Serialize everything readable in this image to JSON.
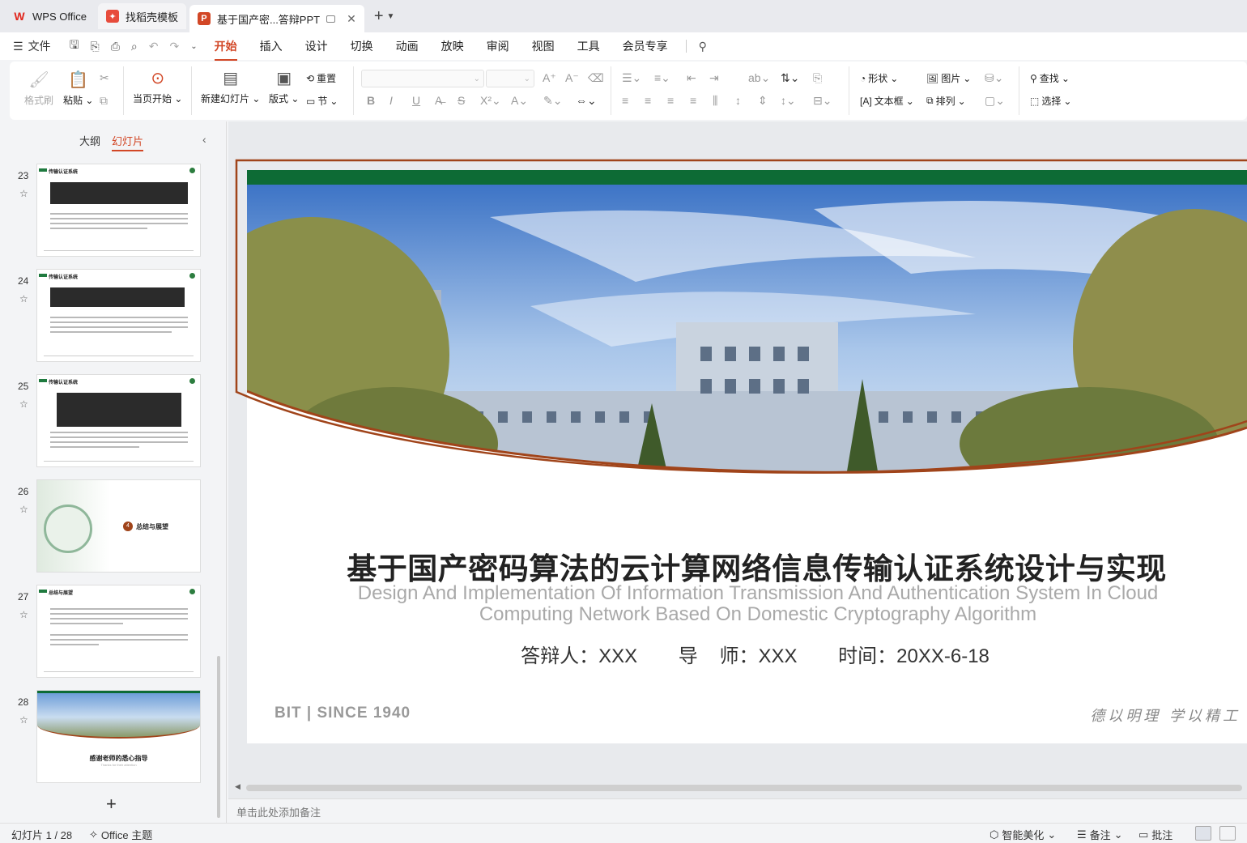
{
  "tabs": [
    {
      "label": "WPS Office",
      "icon": "wps-logo-icon"
    },
    {
      "label": "找稻壳模板",
      "icon": "docer-icon"
    },
    {
      "label": "基于国产密...答辩PPT",
      "icon": "ppt-file-icon"
    }
  ],
  "menu": {
    "file": "文件",
    "items": [
      "开始",
      "插入",
      "设计",
      "切换",
      "动画",
      "放映",
      "审阅",
      "视图",
      "工具",
      "会员专享"
    ],
    "active": "开始"
  },
  "ribbon": {
    "format_painter": "格式刷",
    "paste": "粘贴",
    "play_from_current": "当页开始",
    "new_slide": "新建幻灯片",
    "layout": "版式",
    "reset": "重置",
    "section": "节",
    "shape": "形状",
    "picture": "图片",
    "textbox": "文本框",
    "arrange": "排列",
    "find": "查找",
    "select": "选择"
  },
  "left_panel": {
    "tab_outline": "大纲",
    "tab_slides": "幻灯片",
    "thumbnails": [
      {
        "num": "23",
        "title": "传输认证系统"
      },
      {
        "num": "24",
        "title": "传输认证系统"
      },
      {
        "num": "25",
        "title": "传输认证系统"
      },
      {
        "num": "26",
        "title": "总结与展望",
        "badge": "4"
      },
      {
        "num": "27",
        "title": "总结与展望"
      },
      {
        "num": "28",
        "title": "感谢老师的悉心指导",
        "subtitle": "Thanks for their attention"
      }
    ]
  },
  "slide": {
    "title": "基于国产密码算法的云计算网络信息传输认证系统设计与实现",
    "subtitle": "Design And Implementation Of Information Transmission And Authentication System In Cloud Computing Network Based On Domestic Cryptography Algorithm",
    "presenter": "答辩人：XXX",
    "advisor": "导    师：XXX",
    "time": "时间：20XX-6-18",
    "footer": "BIT | SINCE 1940",
    "motto": "德以明理  学以精工",
    "colors": {
      "green": "#0d6b35",
      "brown": "#a0441a"
    }
  },
  "notes_placeholder": "单击此处添加备注",
  "status": {
    "slide_count": "幻灯片 1 / 28",
    "theme": "Office 主题",
    "beautify": "智能美化",
    "notes": "备注",
    "comments": "批注"
  }
}
